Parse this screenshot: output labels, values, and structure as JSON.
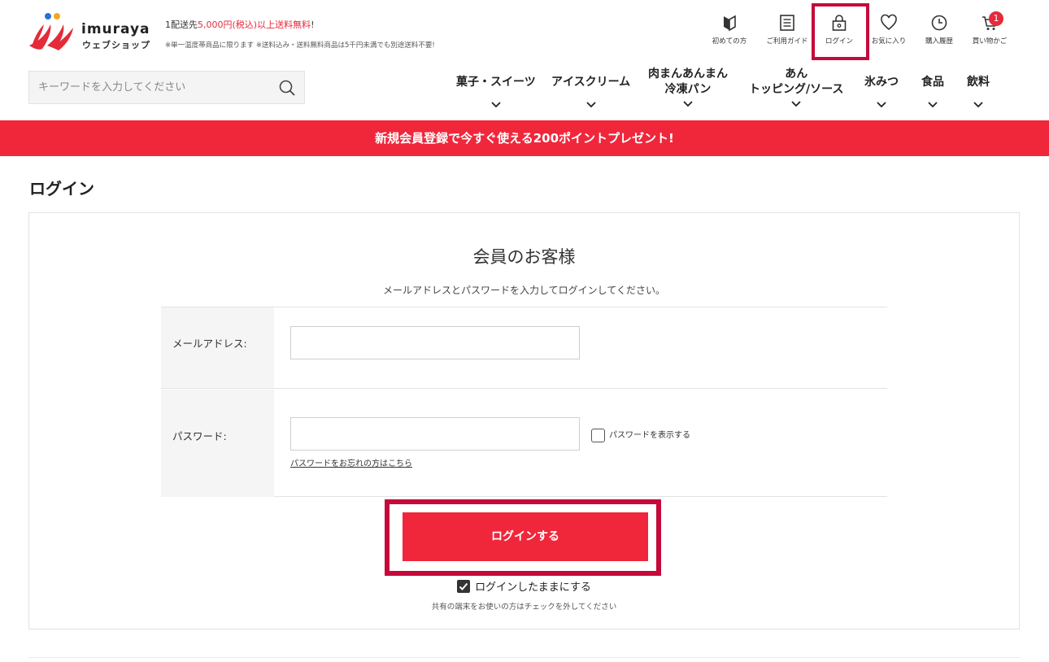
{
  "header": {
    "brand_name": "imuraya",
    "brand_sub": "ウェブショップ",
    "promo_prefix": "1配送先",
    "promo_red": "5,000円(税込)以上送料無料",
    "promo_suffix": "!",
    "promo_note": "※単一温度帯商品に限ります ※送料込み・送料無料商品は5千円未満でも別途送料不要!",
    "icon_nav": [
      {
        "label": "初めての方",
        "icon": "beginner-mark-icon"
      },
      {
        "label": "ご利用ガイド",
        "icon": "guide-document-icon"
      },
      {
        "label": "ログイン",
        "icon": "lock-bag-icon"
      },
      {
        "label": "お気に入り",
        "icon": "heart-icon"
      },
      {
        "label": "購入履歴",
        "icon": "clock-icon"
      },
      {
        "label": "買い物かご",
        "icon": "cart-icon"
      }
    ],
    "cart_count": "1",
    "search_placeholder": "キーワードを入力してください",
    "categories": [
      {
        "line1": "菓子・スイーツ",
        "line2": ""
      },
      {
        "line1": "アイスクリーム",
        "line2": ""
      },
      {
        "line1": "肉まんあんまん",
        "line2": "冷凍パン"
      },
      {
        "line1": "あん",
        "line2": "トッピング/ソース"
      },
      {
        "line1": "氷みつ",
        "line2": ""
      },
      {
        "line1": "食品",
        "line2": ""
      },
      {
        "line1": "飲料",
        "line2": ""
      }
    ]
  },
  "banner": "新規会員登録で今すぐ使える200ポイントプレゼント!",
  "page_title": "ログイン",
  "login": {
    "heading": "会員のお客様",
    "description": "メールアドレスとパスワードを入力してログインしてください。",
    "email_label": "メールアドレス:",
    "email_value": "",
    "password_label": "パスワード:",
    "password_value": "",
    "show_password_label": "パスワードを表示する",
    "forgot_link": "パスワードをお忘れの方はこちら",
    "submit_label": "ログインする",
    "keep_login_label": "ログインしたままにする",
    "keep_login_checked": true,
    "keep_login_note": "共有の端末をお使いの方はチェックを外してください"
  },
  "colors": {
    "accent": "#f0273b",
    "highlight": "#c5093b"
  }
}
